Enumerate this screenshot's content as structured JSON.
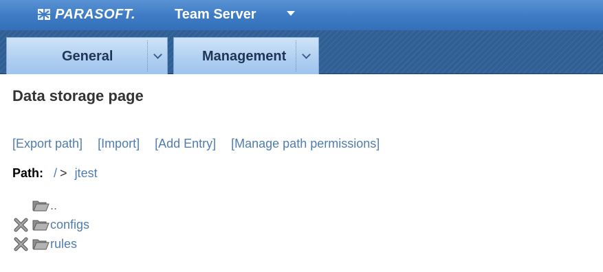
{
  "header": {
    "logo_text": "PARASOFT.",
    "product_name": "Team Server"
  },
  "nav": {
    "tabs": [
      {
        "label": "General"
      },
      {
        "label": "Management"
      }
    ]
  },
  "page": {
    "title": "Data storage page",
    "actions": [
      "[Export path]",
      "[Import]",
      "[Add Entry]",
      "[Manage path permissions]"
    ],
    "path": {
      "label": "Path:",
      "segments": [
        "/",
        "jtest"
      ],
      "separator": ">"
    },
    "entries": [
      {
        "name": "..",
        "deletable": false
      },
      {
        "name": "configs",
        "deletable": true
      },
      {
        "name": "rules",
        "deletable": true
      }
    ]
  },
  "colors": {
    "banner": "#3f7cc6",
    "nav_bg": "#2f5f94",
    "tab": "#b1d0f1",
    "link": "#4f7db0"
  }
}
